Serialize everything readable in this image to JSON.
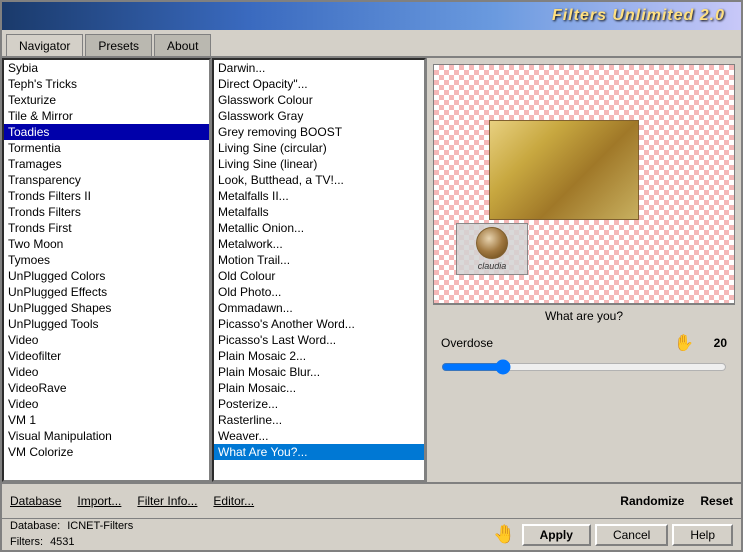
{
  "titleBar": {
    "title": "Filters Unlimited 2.0"
  },
  "tabs": [
    {
      "id": "navigator",
      "label": "Navigator",
      "active": true
    },
    {
      "id": "presets",
      "label": "Presets",
      "active": false
    },
    {
      "id": "about",
      "label": "About",
      "active": false
    }
  ],
  "leftList": {
    "items": [
      "Sybia",
      "Teph's Tricks",
      "Texturize",
      "Tile & Mirror",
      "Toadies",
      "Tormentia",
      "Tramages",
      "Transparency",
      "Tronds Filters II",
      "Tronds Filters",
      "Tronds First",
      "Two Moon",
      "Tymoes",
      "UnPlugged Colors",
      "UnPlugged Effects",
      "UnPlugged Shapes",
      "UnPlugged Tools",
      "Video",
      "Videofilter",
      "Video",
      "VideoRave",
      "Video",
      "VM 1",
      "Visual Manipulation",
      "VM Colorize"
    ],
    "selectedIndex": 4
  },
  "middleList": {
    "items": [
      "Darwin...",
      "Direct Opacity\"...",
      "Glasswork Colour",
      "Glasswork Gray",
      "Grey removing BOOST",
      "Living Sine (circular)",
      "Living Sine (linear)",
      "Look, Butthead, a TV!...",
      "Metalfalls II...",
      "Metalfalls",
      "Metallic Onion...",
      "Metalwork...",
      "Motion Trail...",
      "Old Colour",
      "Old Photo...",
      "Ommadawn...",
      "Picasso's Another Word...",
      "Picasso's Last Word...",
      "Plain Mosaic 2...",
      "Plain Mosaic Blur...",
      "Plain Mosaic...",
      "Posterize...",
      "Rasterline...",
      "Weaver...",
      "What Are You?..."
    ],
    "selectedIndex": 24
  },
  "filterInfo": {
    "whatAreYou": "What are you?",
    "overdoseLabel": "Overdose",
    "overdoseValue": "20"
  },
  "toolbar": {
    "database": "Database",
    "import": "Import...",
    "filterInfo": "Filter Info...",
    "editor": "Editor...",
    "randomize": "Randomize",
    "reset": "Reset"
  },
  "statusBar": {
    "databaseLabel": "Database:",
    "databaseValue": "ICNET-Filters",
    "filtersLabel": "Filters:",
    "filtersValue": "4531"
  },
  "buttons": {
    "apply": "Apply",
    "cancel": "Cancel",
    "help": "Help"
  },
  "watermarkText": "claudia",
  "colors": {
    "titleGradientStart": "#1a3a6b",
    "titleGradientEnd": "#c8c8f8",
    "titleText": "#ffe080",
    "accent": "#0000aa"
  }
}
